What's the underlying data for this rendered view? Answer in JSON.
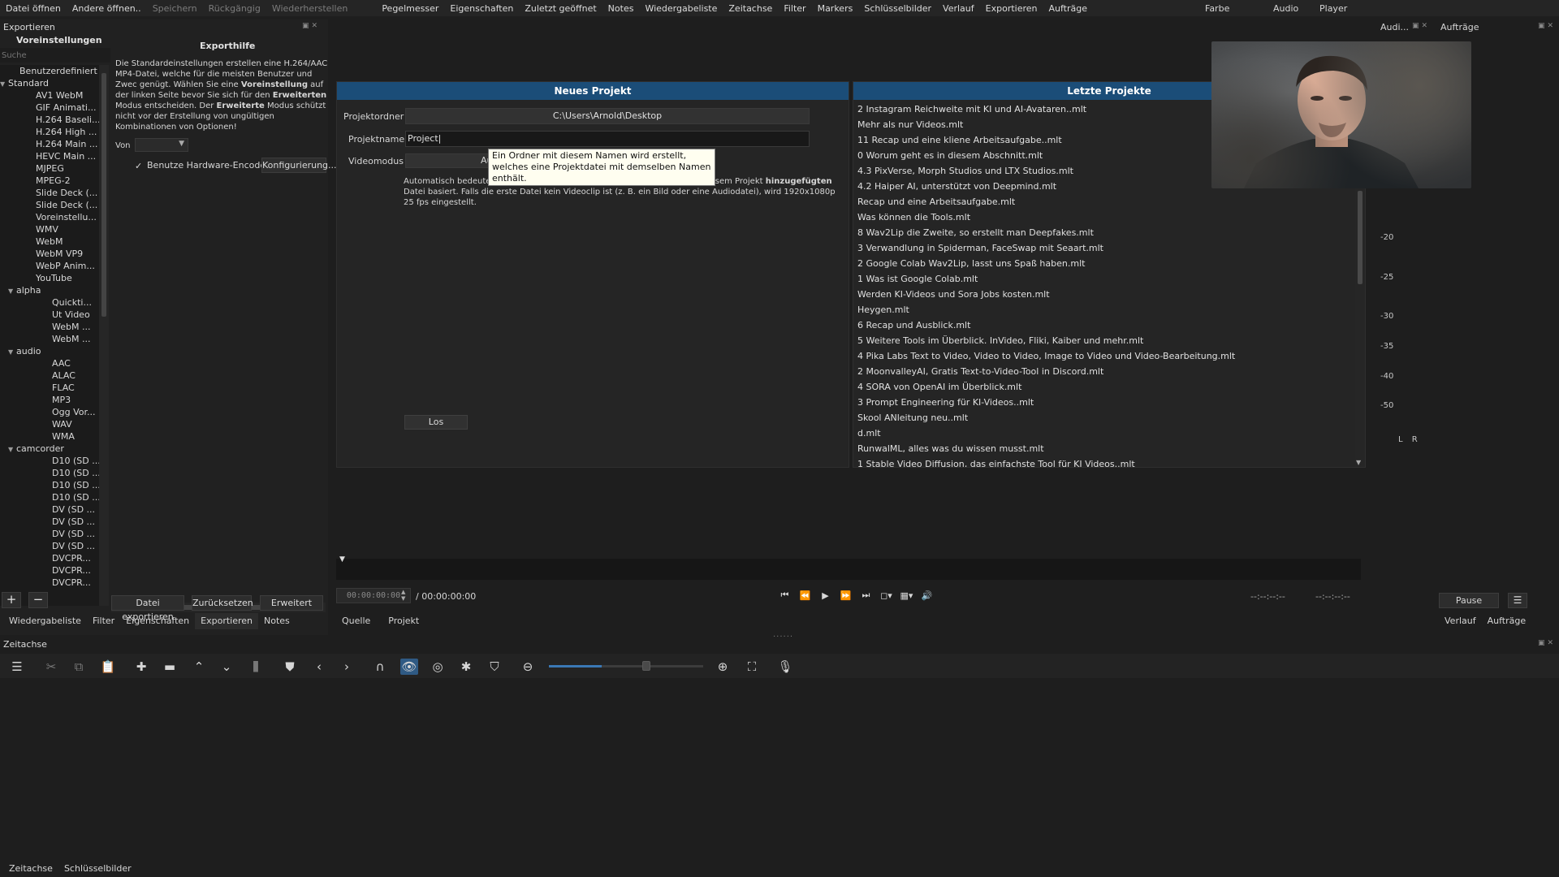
{
  "menubar": {
    "items": [
      {
        "label": "Datei öffnen",
        "enabled": true
      },
      {
        "label": "Andere öffnen..",
        "enabled": true
      },
      {
        "label": "Speichern",
        "enabled": false
      },
      {
        "label": "Rückgängig",
        "enabled": false
      },
      {
        "label": "Wiederherstellen",
        "enabled": false
      },
      {
        "label": "Pegelmesser",
        "enabled": true
      },
      {
        "label": "Eigenschaften",
        "enabled": true
      },
      {
        "label": "Zuletzt geöffnet",
        "enabled": true
      },
      {
        "label": "Notes",
        "enabled": true
      },
      {
        "label": "Wiedergabeliste",
        "enabled": true
      },
      {
        "label": "Zeitachse",
        "enabled": true
      },
      {
        "label": "Filter",
        "enabled": true
      },
      {
        "label": "Markers",
        "enabled": true
      },
      {
        "label": "Schlüsselbilder",
        "enabled": true
      },
      {
        "label": "Verlauf",
        "enabled": true
      },
      {
        "label": "Exportieren",
        "enabled": true
      },
      {
        "label": "Aufträge",
        "enabled": true
      }
    ],
    "layouts": [
      "Farbe",
      "Audio",
      "Player"
    ]
  },
  "export": {
    "panel_title": "Exportieren",
    "presets_title": "Voreinstellungen",
    "search_placeholder": "Suche",
    "tree": [
      {
        "label": "Benutzerdefiniert",
        "level": 1,
        "toggle": ""
      },
      {
        "label": "Standard",
        "level": 0,
        "toggle": "▼"
      },
      {
        "label": "AV1 WebM",
        "level": 2,
        "toggle": ""
      },
      {
        "label": "GIF Animati...",
        "level": 2,
        "toggle": ""
      },
      {
        "label": "H.264 Baseli...",
        "level": 2,
        "toggle": ""
      },
      {
        "label": "H.264 High ...",
        "level": 2,
        "toggle": ""
      },
      {
        "label": "H.264 Main ...",
        "level": 2,
        "toggle": ""
      },
      {
        "label": "HEVC Main ...",
        "level": 2,
        "toggle": ""
      },
      {
        "label": "MJPEG",
        "level": 2,
        "toggle": ""
      },
      {
        "label": "MPEG-2",
        "level": 2,
        "toggle": ""
      },
      {
        "label": "Slide Deck (...",
        "level": 2,
        "toggle": ""
      },
      {
        "label": "Slide Deck (...",
        "level": 2,
        "toggle": ""
      },
      {
        "label": "Voreinstellu...",
        "level": 2,
        "toggle": ""
      },
      {
        "label": "WMV",
        "level": 2,
        "toggle": ""
      },
      {
        "label": "WebM",
        "level": 2,
        "toggle": ""
      },
      {
        "label": "WebM VP9",
        "level": 2,
        "toggle": ""
      },
      {
        "label": "WebP Anim...",
        "level": 2,
        "toggle": ""
      },
      {
        "label": "YouTube",
        "level": 2,
        "toggle": ""
      },
      {
        "label": "alpha",
        "level": 1,
        "toggle": "▼"
      },
      {
        "label": "Quickti...",
        "level": 3,
        "toggle": ""
      },
      {
        "label": "Ut Video",
        "level": 3,
        "toggle": ""
      },
      {
        "label": "WebM ...",
        "level": 3,
        "toggle": ""
      },
      {
        "label": "WebM ...",
        "level": 3,
        "toggle": ""
      },
      {
        "label": "audio",
        "level": 1,
        "toggle": "▼"
      },
      {
        "label": "AAC",
        "level": 3,
        "toggle": ""
      },
      {
        "label": "ALAC",
        "level": 3,
        "toggle": ""
      },
      {
        "label": "FLAC",
        "level": 3,
        "toggle": ""
      },
      {
        "label": "MP3",
        "level": 3,
        "toggle": ""
      },
      {
        "label": "Ogg Vor...",
        "level": 3,
        "toggle": ""
      },
      {
        "label": "WAV",
        "level": 3,
        "toggle": ""
      },
      {
        "label": "WMA",
        "level": 3,
        "toggle": ""
      },
      {
        "label": "camcorder",
        "level": 1,
        "toggle": "▼"
      },
      {
        "label": "D10 (SD ...",
        "level": 3,
        "toggle": ""
      },
      {
        "label": "D10 (SD ...",
        "level": 3,
        "toggle": ""
      },
      {
        "label": "D10 (SD ...",
        "level": 3,
        "toggle": ""
      },
      {
        "label": "D10 (SD ...",
        "level": 3,
        "toggle": ""
      },
      {
        "label": "DV (SD ...",
        "level": 3,
        "toggle": ""
      },
      {
        "label": "DV (SD ...",
        "level": 3,
        "toggle": ""
      },
      {
        "label": "DV (SD ...",
        "level": 3,
        "toggle": ""
      },
      {
        "label": "DV (SD ...",
        "level": 3,
        "toggle": ""
      },
      {
        "label": "DVCPR...",
        "level": 3,
        "toggle": ""
      },
      {
        "label": "DVCPR...",
        "level": 3,
        "toggle": ""
      },
      {
        "label": "DVCPR...",
        "level": 3,
        "toggle": ""
      }
    ],
    "help_title": "Exporthilfe",
    "help_text_parts": [
      {
        "t": "Die Standardeinstellungen erstellen eine H.264/AAC MP4-Datei, welche für die meisten Benutzer und Zwec genügt. Wählen Sie eine ",
        "b": false
      },
      {
        "t": "Voreinstellung",
        "b": true
      },
      {
        "t": " auf der linken Seite bevor Sie sich für den ",
        "b": false
      },
      {
        "t": "Erweiterten",
        "b": true
      },
      {
        "t": " Modus entscheiden. Der ",
        "b": false
      },
      {
        "t": "Erweiterte",
        "b": true
      },
      {
        "t": " Modus schützt nicht vor der Erstellung von ungültigen Kombinationen von Optionen!",
        "b": false
      }
    ],
    "from_label": "Von",
    "hw_encoder_label": "Benutze Hardware-Encoder",
    "configure_label": "Konfigurierung...",
    "export_file_label": "Datei exportieren",
    "reset_label": "Zurücksetzen",
    "advanced_label": "Erweitert",
    "add_symbol": "+",
    "remove_symbol": "−"
  },
  "left_tabs": [
    "Wiedergabeliste",
    "Filter",
    "Eigenschaften",
    "Exportieren",
    "Notes"
  ],
  "left_tabs_active": 3,
  "new_project": {
    "header": "Neues Projekt",
    "folder_label": "Projektordner",
    "folder_value": "C:\\Users\\Arnold\\Desktop",
    "name_label": "Projektname",
    "name_value": "Project",
    "videomode_label": "Videomodus",
    "videomode_value": "Au",
    "auto_text_parts": [
      {
        "t": "Automatisch bedeutet, dass die Auflösung und Bildrate auf der ersten zu diesem Projekt ",
        "b": false
      },
      {
        "t": "hinzugefügten",
        "b": true
      },
      {
        "t": " Datei basiert. Falls die erste Datei kein Videoclip ist (z. B. ein Bild oder eine Audiodatei), wird 1920x1080p 25 fps eingestellt.",
        "b": false
      }
    ],
    "tooltip": "Ein Ordner mit diesem Namen wird erstellt, welches eine Projektdatei mit demselben Namen enthält.",
    "go_label": "Los"
  },
  "recent_projects": {
    "header": "Letzte Projekte",
    "items": [
      "2 Instagram Reichweite mit KI und AI-Avataren..mlt",
      "Mehr als nur Videos.mlt",
      "11 Recap und eine kliene Arbeitsaufgabe..mlt",
      "0 Worum geht es in diesem Abschnitt.mlt",
      "4.3 PixVerse, Morph Studios und LTX Studios.mlt",
      "4.2 Haiper AI, unterstützt von Deepmind.mlt",
      "Recap und eine Arbeitsaufgabe.mlt",
      "Was können die Tools.mlt",
      "8 Wav2Lip die Zweite, so erstellt man Deepfakes.mlt",
      "3 Verwandlung in Spiderman, FaceSwap mit Seaart.mlt",
      "2 Google Colab Wav2Lip, lasst uns Spaß haben.mlt",
      "1 Was ist Google Colab.mlt",
      "Werden KI-Videos und Sora Jobs kosten.mlt",
      "Heygen.mlt",
      "6 Recap und Ausblick.mlt",
      "5 Weitere Tools im Überblick. InVideo, Fliki, Kaiber und mehr.mlt",
      "4 Pika Labs Text to Video, Video to Video, Image to Video und Video-Bearbeitung.mlt",
      "2 MoonvalleyAI, Gratis Text-to-Video-Tool in Discord.mlt",
      "4 SORA von OpenAI im Überblick.mlt",
      "3 Prompt Engineering für KI-Videos..mlt",
      "Skool ANleitung neu..mlt",
      "d.mlt",
      "RunwalML, alles was du wissen musst.mlt",
      "1 Stable Video Diffusion, das einfachste Tool für KI Videos..mlt"
    ]
  },
  "audio_meter": {
    "panel_title": "Audi...",
    "jobs_title": "Aufträge",
    "db_labels": [
      "-20",
      "-25",
      "-30",
      "-35",
      "-40",
      "-50"
    ],
    "lr_label": "L R"
  },
  "player": {
    "timecode_current": "00:00:00:00",
    "timecode_total": "/ 00:00:00:00",
    "in_point": "--:--:--:--",
    "out_point": "--:--:--:--",
    "source_tab": "Quelle",
    "project_tab": "Projekt"
  },
  "jobs": {
    "pause_label": "Pause",
    "menu_symbol": "☰",
    "tabs": [
      "Verlauf",
      "Aufträge"
    ]
  },
  "timeline": {
    "title": "Zeitachse",
    "zoom_level": 0.34,
    "bottom_tabs": [
      "Zeitachse",
      "Schlüsselbilder"
    ]
  },
  "colors": {
    "accent": "#1b4d78",
    "toggle_on": "#2f5a84",
    "zoom_fill": "#3a78b4"
  }
}
